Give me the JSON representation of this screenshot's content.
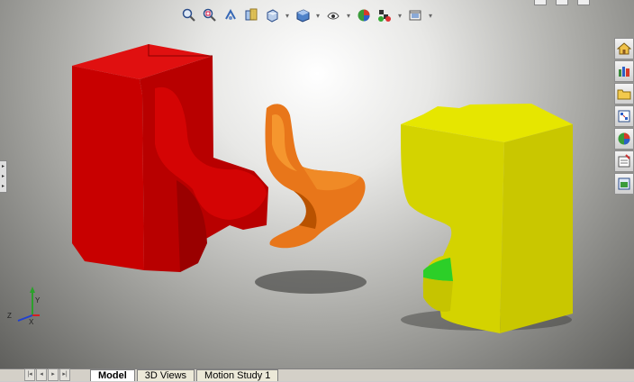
{
  "hud": {
    "buttons": [
      {
        "name": "zoom-to-fit-icon"
      },
      {
        "name": "zoom-to-area-icon"
      },
      {
        "name": "previous-view-icon"
      },
      {
        "name": "section-view-icon"
      },
      {
        "name": "view-orientation-icon"
      },
      {
        "name": "display-style-icon"
      },
      {
        "name": "hide-show-items-icon"
      },
      {
        "name": "edit-appearance-icon"
      },
      {
        "name": "apply-scene-icon"
      },
      {
        "name": "view-settings-icon"
      }
    ]
  },
  "task_pane": {
    "buttons": [
      "home-icon",
      "design-library-icon",
      "file-explorer-icon",
      "view-palette-icon",
      "appearances-icon",
      "custom-properties-icon",
      "document-recovery-icon"
    ]
  },
  "triad": {
    "x_label": "X",
    "y_label": "Y",
    "z_label": "Z"
  },
  "tabs": [
    {
      "label": "Model",
      "active": true
    },
    {
      "label": "3D Views",
      "active": false
    },
    {
      "label": "Motion Study 1",
      "active": false
    }
  ],
  "colors": {
    "red_block": "#d60000",
    "orange_chair": "#e06a00",
    "yellow_block": "#d7d400",
    "green_seat": "#28c828"
  }
}
